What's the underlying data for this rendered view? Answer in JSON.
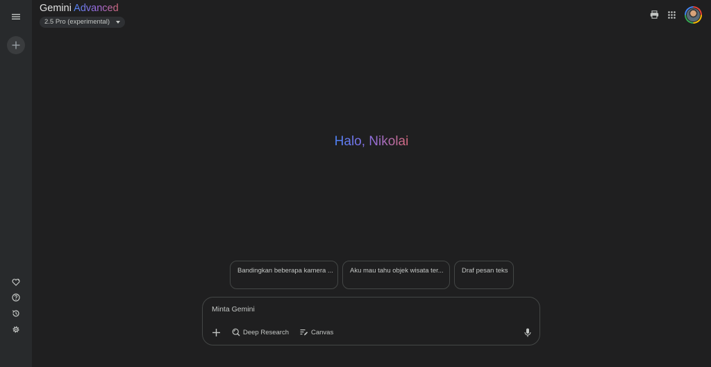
{
  "app": {
    "brand_name": "Gemini",
    "brand_tier": "Advanced"
  },
  "model_selector": {
    "label": "2.5 Pro (experimental)"
  },
  "greeting": {
    "text": "Halo, Nikolai"
  },
  "suggestions": [
    {
      "label": "Bandingkan beberapa kamera ..."
    },
    {
      "label": "Aku mau tahu objek wisata ter..."
    },
    {
      "label": "Draf pesan teks"
    }
  ],
  "prompt": {
    "placeholder": "Minta Gemini",
    "tools": {
      "deep_research": "Deep Research",
      "canvas": "Canvas"
    }
  },
  "icons": {
    "sidebar": [
      "menu-icon",
      "new-chat-icon",
      "gem-manager-icon",
      "help-icon",
      "activity-icon",
      "settings-icon"
    ],
    "header": [
      "print-icon",
      "apps-grid-icon",
      "avatar"
    ],
    "prompt": [
      "plus-icon",
      "deep-research-icon",
      "canvas-icon",
      "microphone-icon"
    ]
  },
  "colors": {
    "background": "#1f1f20",
    "sidebar": "#282a2c",
    "border": "#444746",
    "text": "#e3e3e3",
    "gradient_start": "#4d82f6",
    "gradient_end": "#d66a7d"
  }
}
